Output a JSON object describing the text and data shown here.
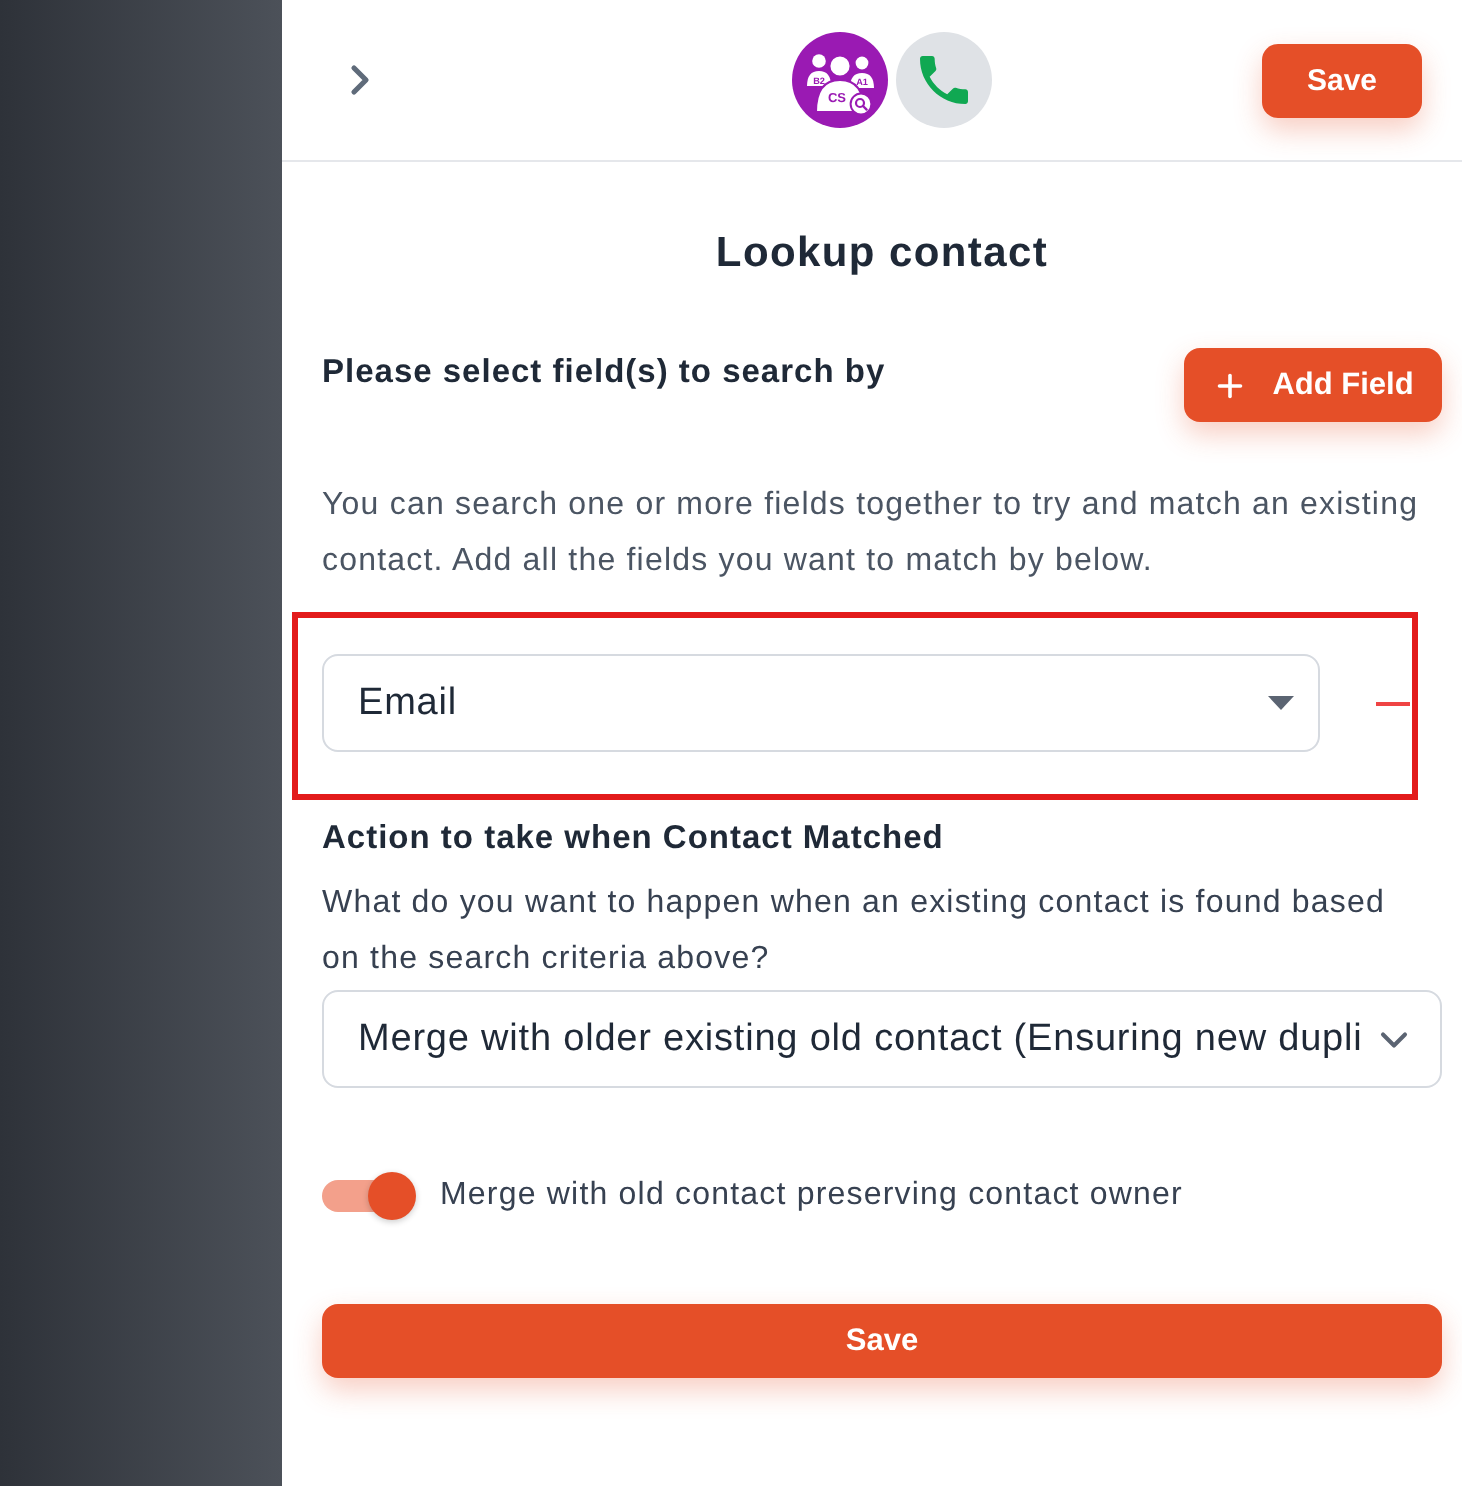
{
  "header": {
    "app_icons": [
      {
        "kind": "contact-search",
        "labels": [
          "B2",
          "A1",
          "CS"
        ]
      },
      {
        "kind": "phone"
      }
    ],
    "save_button": "Save"
  },
  "title": "Lookup contact",
  "search_fields": {
    "heading": "Please select field(s) to search by",
    "add_button": "Add Field",
    "description": "You can search one or more fields together to try and match an existing contact. Add all the fields you want to match by below.",
    "fields": [
      {
        "value": "Email",
        "highlighted": true
      }
    ]
  },
  "match_action": {
    "heading": "Action to take when Contact Matched",
    "description": "What do you want to happen when an existing contact is found based on the search criteria above?",
    "selected_option": "Merge with older existing old contact (Ensuring new dupli",
    "preserve_owner": {
      "label": "Merge with old contact preserving contact owner",
      "on": true
    }
  },
  "save_button": "Save"
}
